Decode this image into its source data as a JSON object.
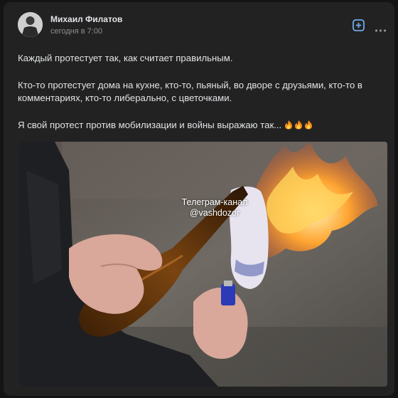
{
  "post": {
    "author": "Михаил Филатов",
    "time": "сегодня в 7:00",
    "paragraphs": [
      "Каждый протестует так, как считает правильным.",
      "Кто-то протестует дома на кухне, кто-то, пьяный, во дворе с друзьями, кто-то в комментариях, кто-то либерально, с цветочками.",
      "Я свой протест против мобилизации и войны выражаю так..."
    ],
    "emoji": [
      "fire-emoji",
      "fire-emoji",
      "fire-emoji"
    ]
  },
  "photo": {
    "watermark_line1": "Телеграм-канал",
    "watermark_line2": "@vashdozor"
  },
  "icons": {
    "add": "plus-square-icon",
    "more": "more-dots-icon"
  },
  "colors": {
    "card_bg": "#222222",
    "text": "#e1e3e6",
    "secondary": "#8c8f94",
    "accent": "#71aaeb"
  }
}
